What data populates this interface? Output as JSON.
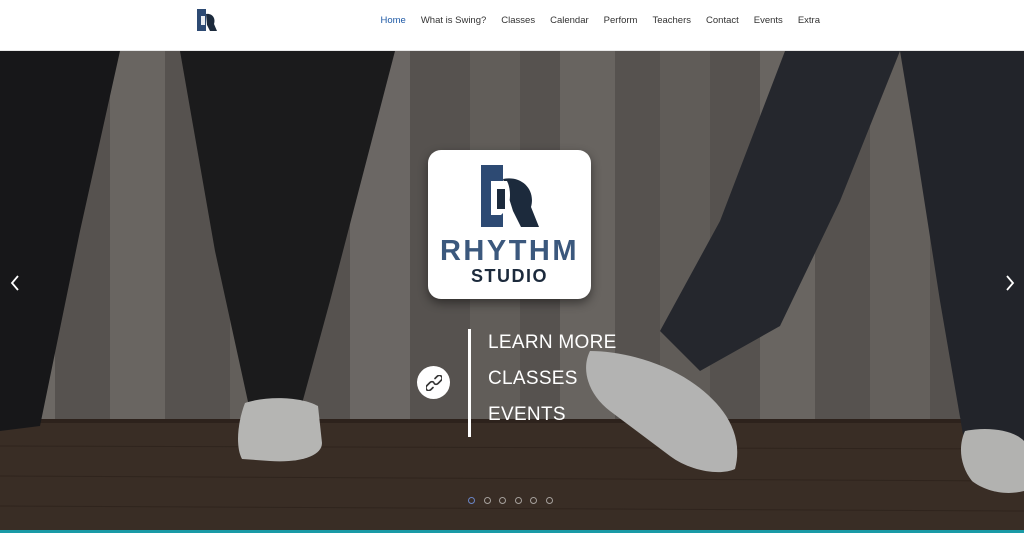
{
  "header": {
    "logo_icon": "rhythm-studio-logo",
    "nav": [
      {
        "label": "Home",
        "active": true
      },
      {
        "label": "What is Swing?",
        "active": false
      },
      {
        "label": "Classes",
        "active": false
      },
      {
        "label": "Calendar",
        "active": false
      },
      {
        "label": "Perform",
        "active": false
      },
      {
        "label": "Teachers",
        "active": false
      },
      {
        "label": "Contact",
        "active": false
      },
      {
        "label": "Events",
        "active": false
      },
      {
        "label": "Extra",
        "active": false
      }
    ]
  },
  "hero": {
    "brand_line1": "RHYTHM",
    "brand_line2": "STUDIO",
    "links": [
      "LEARN MORE",
      "CLASSES",
      "EVENTS"
    ],
    "link_icon": "link-icon",
    "slides": 6,
    "active_slide": 0
  },
  "colors": {
    "nav_active": "#1f5aa6",
    "brand_blue": "#3b587d",
    "brand_dark": "#1c2a3c",
    "accent_bar": "#1a9aa6"
  }
}
